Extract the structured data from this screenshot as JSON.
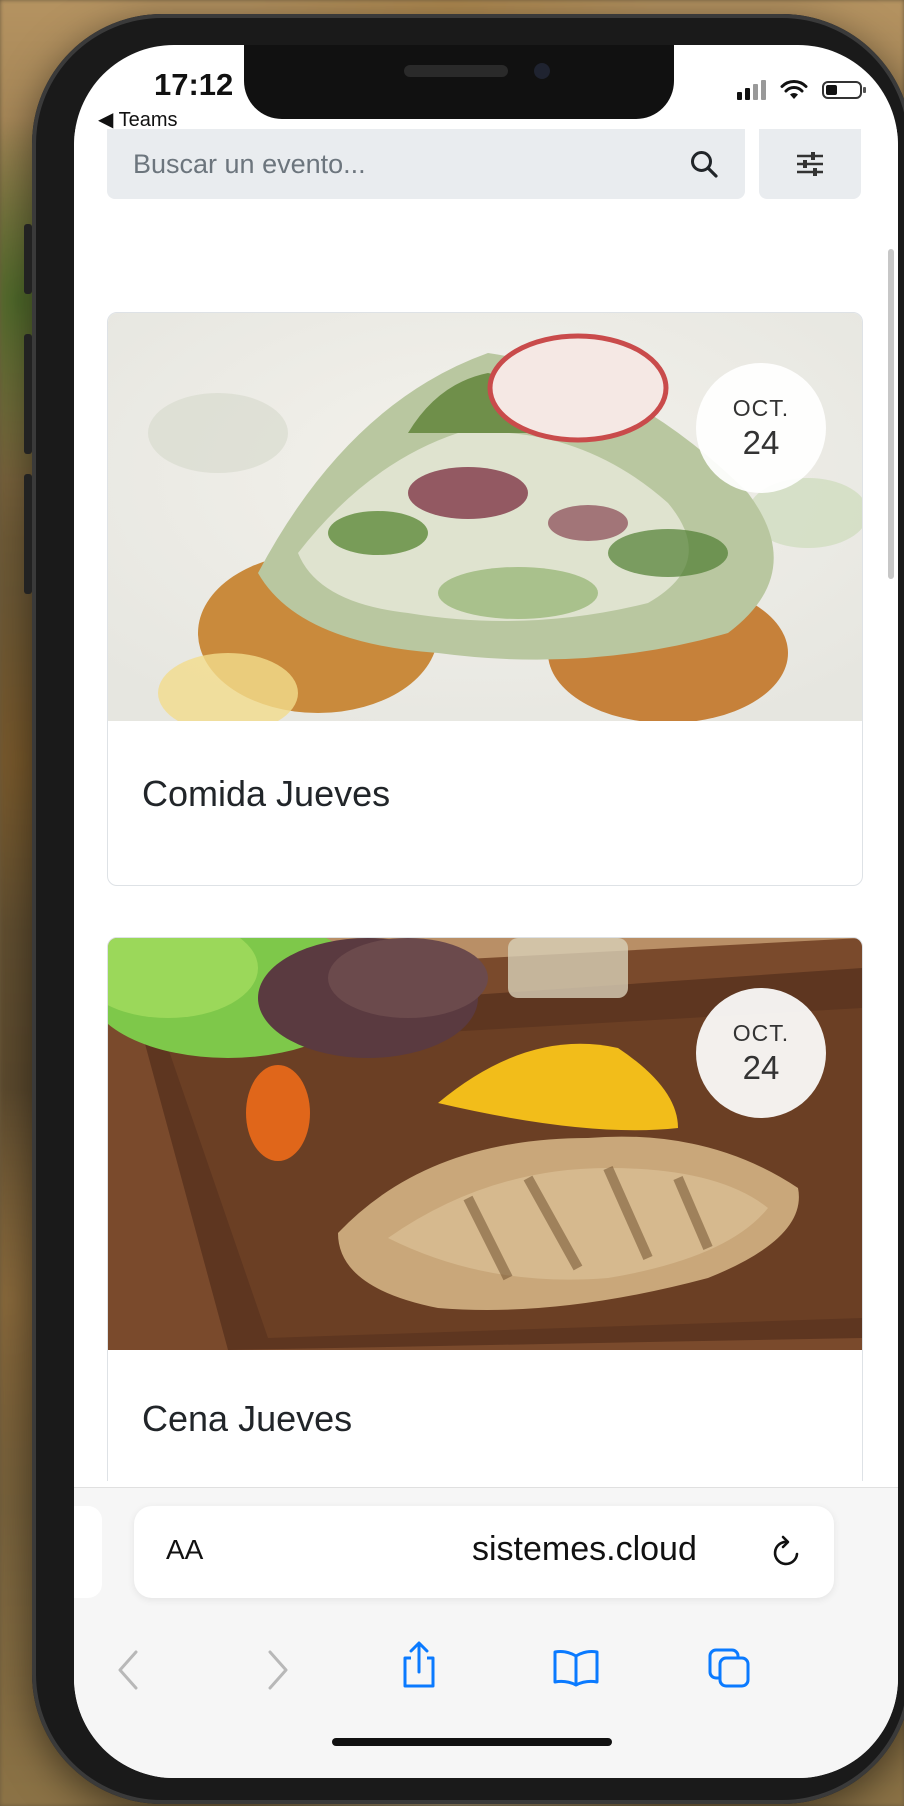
{
  "status": {
    "time": "17:12",
    "back_app": "◀ Teams"
  },
  "search": {
    "placeholder": "Buscar un evento..."
  },
  "events": [
    {
      "title": "Comida Jueves",
      "month": "OCT.",
      "day": "24"
    },
    {
      "title": "Cena Jueves",
      "month": "OCT.",
      "day": "24"
    }
  ],
  "browser": {
    "text_size_label": "AA",
    "url": "sistemes.cloud"
  },
  "icons": {
    "search": "magnifier-icon",
    "filter": "sliders-icon",
    "reload": "reload-icon",
    "back": "chevron-left-icon",
    "forward": "chevron-right-icon",
    "share": "share-icon",
    "bookmarks": "book-icon",
    "tabs": "tabs-icon"
  },
  "colors": {
    "accent": "#0a7aff",
    "search_bg": "#e9ecef",
    "text": "#212529"
  }
}
